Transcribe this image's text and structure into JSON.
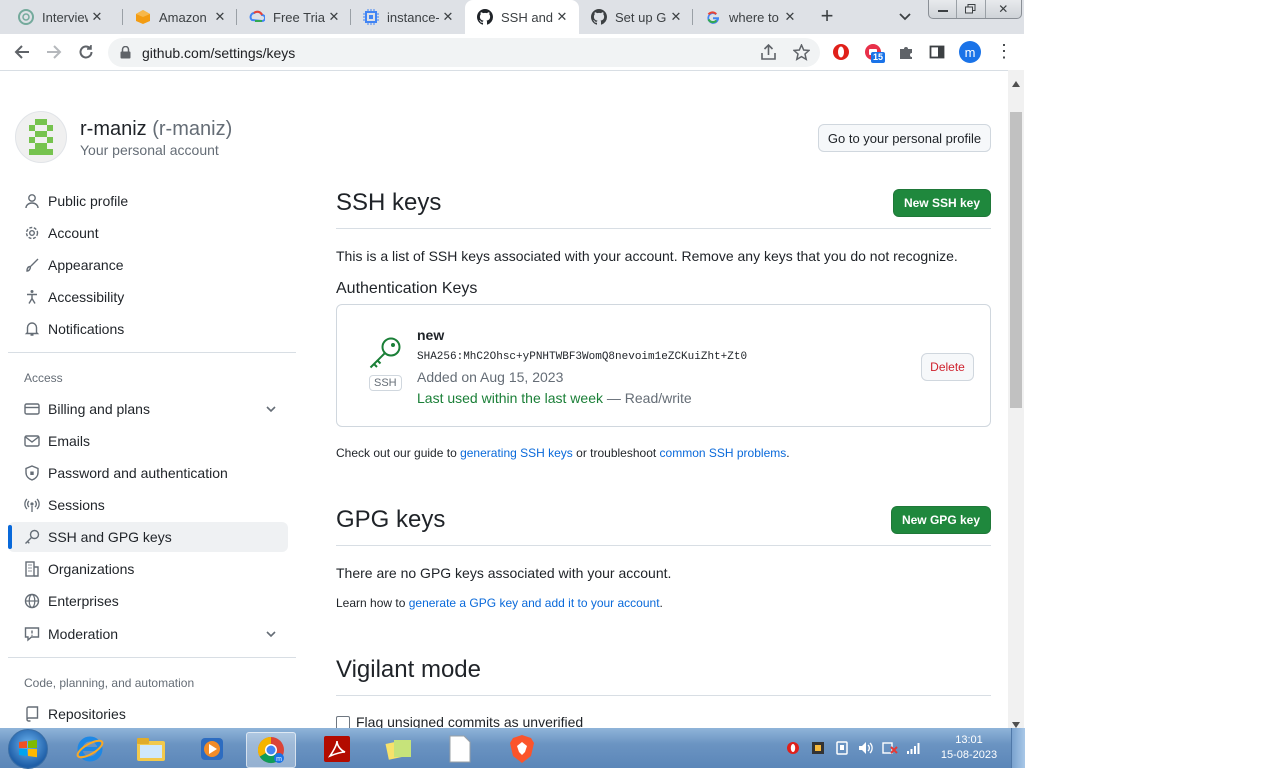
{
  "browser": {
    "tabs": [
      {
        "title": "Interview",
        "icon": "chatgpt-icon"
      },
      {
        "title": "Amazon",
        "icon": "aws-icon"
      },
      {
        "title": "Free Trial",
        "icon": "google-cloud-icon"
      },
      {
        "title": "instance-",
        "icon": "compute-engine-icon"
      },
      {
        "title": "SSH and",
        "icon": "github-icon"
      },
      {
        "title": "Set up Gi",
        "icon": "github-icon"
      },
      {
        "title": "where to",
        "icon": "google-icon"
      }
    ],
    "url": "github.com/settings/keys",
    "extension_badge": "15",
    "profile_initial": "m"
  },
  "account": {
    "username": "r-maniz",
    "handle": "(r-maniz)",
    "subtitle": "Your personal account",
    "profile_button": "Go to your personal profile"
  },
  "sidebar": {
    "items_top": [
      {
        "label": "Public profile",
        "icon": "person-icon"
      },
      {
        "label": "Account",
        "icon": "gear-icon"
      },
      {
        "label": "Appearance",
        "icon": "paintbrush-icon"
      },
      {
        "label": "Accessibility",
        "icon": "accessibility-icon"
      },
      {
        "label": "Notifications",
        "icon": "bell-icon"
      }
    ],
    "access_heading": "Access",
    "items_access": [
      {
        "label": "Billing and plans",
        "icon": "credit-card-icon"
      },
      {
        "label": "Emails",
        "icon": "mail-icon"
      },
      {
        "label": "Password and authentication",
        "icon": "shield-lock-icon"
      },
      {
        "label": "Sessions",
        "icon": "broadcast-icon"
      },
      {
        "label": "SSH and GPG keys",
        "icon": "key-icon"
      },
      {
        "label": "Organizations",
        "icon": "organization-icon"
      },
      {
        "label": "Enterprises",
        "icon": "globe-icon"
      },
      {
        "label": "Moderation",
        "icon": "report-icon"
      }
    ],
    "code_heading": "Code, planning, and automation",
    "items_code": [
      {
        "label": "Repositories",
        "icon": "repo-icon"
      }
    ]
  },
  "ssh": {
    "title": "SSH keys",
    "new_button": "New SSH key",
    "description": "This is a list of SSH keys associated with your account. Remove any keys that you do not recognize.",
    "auth_heading": "Authentication Keys",
    "key": {
      "name": "new",
      "fingerprint": "SHA256:MhC2Ohsc+yPNHTWBF3WomQ8nevoim1eZCKuiZht+Zt0",
      "added": "Added on Aug 15, 2023",
      "last_used": "Last used within the last week",
      "access": "— Read/write",
      "badge": "SSH",
      "delete_button": "Delete"
    },
    "guide_prefix": "Check out our guide to ",
    "guide_link1": "generating SSH keys",
    "guide_middle": " or troubleshoot ",
    "guide_link2": "common SSH problems",
    "guide_suffix": "."
  },
  "gpg": {
    "title": "GPG keys",
    "new_button": "New GPG key",
    "empty": "There are no GPG keys associated with your account.",
    "learn_prefix": "Learn how to ",
    "learn_link": "generate a GPG key and add it to your account",
    "learn_suffix": "."
  },
  "vigilant": {
    "title": "Vigilant mode",
    "checkbox_label": "Flag unsigned commits as unverified"
  },
  "taskbar": {
    "time": "13:01",
    "date": "15-08-2023"
  },
  "colors": {
    "primary_green": "#1f883d",
    "link_blue": "#0969da",
    "last_used_green": "#1a7f37",
    "delete_red": "#cf222e",
    "active_indicator": "#0969da"
  }
}
